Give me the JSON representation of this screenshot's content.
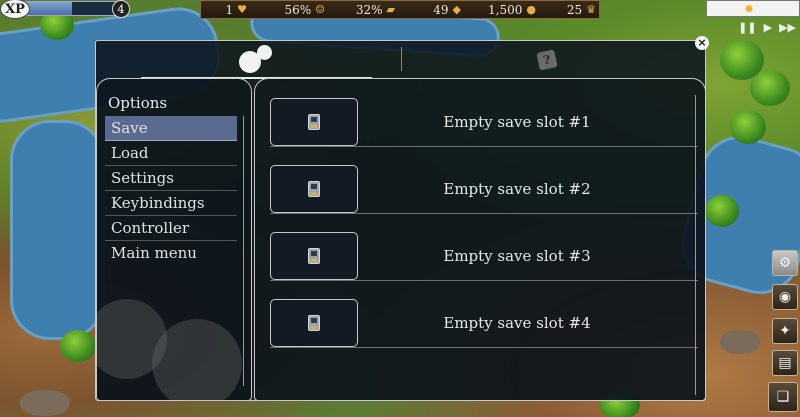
{
  "hud": {
    "xp_label": "XP",
    "xp_progress": 0.52,
    "level": "4",
    "resources": [
      {
        "value": "1",
        "icon": "population-icon"
      },
      {
        "value": "56%",
        "icon": "happiness-icon"
      },
      {
        "value": "32%",
        "icon": "food-icon"
      },
      {
        "value": "49",
        "icon": "supplies-icon"
      },
      {
        "value": "1,500",
        "icon": "gold-icon"
      },
      {
        "value": "25",
        "icon": "crown-icon"
      }
    ],
    "time_icon": "sun-icon",
    "controls": [
      "pause-icon",
      "play-icon",
      "fast-forward-icon"
    ]
  },
  "dialog": {
    "tabs": [
      {
        "icon": "gears-icon",
        "active": true
      },
      {
        "icon": "help-scroll-icon",
        "active": false
      }
    ],
    "menu": {
      "title": "Options",
      "items": [
        "Save",
        "Load",
        "Settings",
        "Keybindings",
        "Controller",
        "Main menu"
      ],
      "selected": "Save"
    },
    "slots": [
      {
        "label": "Empty save slot #1",
        "icon": "floppy-disk-icon"
      },
      {
        "label": "Empty save slot #2",
        "icon": "floppy-disk-icon"
      },
      {
        "label": "Empty save slot #3",
        "icon": "floppy-disk-icon"
      },
      {
        "label": "Empty save slot #4",
        "icon": "floppy-disk-icon"
      }
    ]
  },
  "side_buttons": [
    "map-gear-icon",
    "world-icon",
    "fire-icon",
    "scroll-icon",
    "book-icon"
  ],
  "colors": {
    "selected_item": "#5a6a90",
    "dialog_border": "#c8c8c8",
    "panel_bg": "#0c141e"
  }
}
